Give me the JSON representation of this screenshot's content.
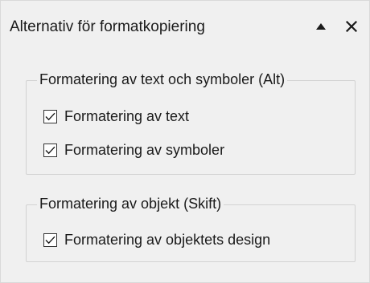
{
  "panel": {
    "title": "Alternativ för formatkopiering",
    "collapse_icon": "triangle-up-icon",
    "close_label": "✕"
  },
  "groups": [
    {
      "legend": "Formatering av text och symboler (Alt)",
      "options": [
        {
          "label": "Formatering av text",
          "checked": true
        },
        {
          "label": "Formatering av symboler",
          "checked": true
        }
      ]
    },
    {
      "legend": "Formatering av objekt (Skift)",
      "options": [
        {
          "label": "Formatering av objektets design",
          "checked": true
        }
      ]
    }
  ]
}
